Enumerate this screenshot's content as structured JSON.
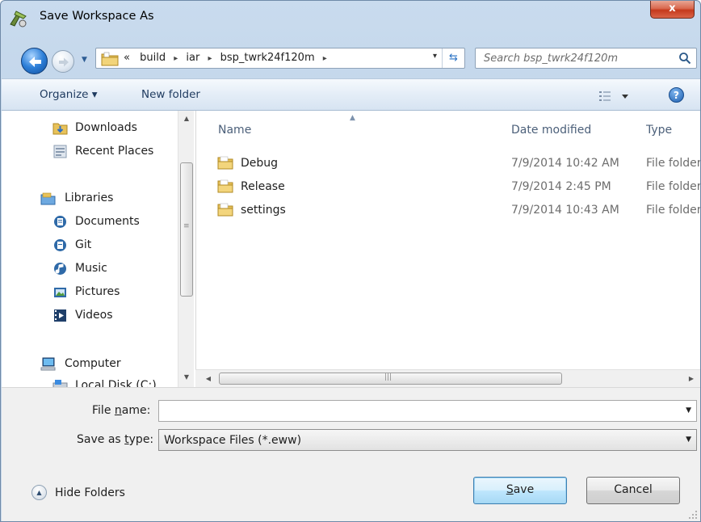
{
  "window": {
    "title": "Save Workspace As",
    "close_label": "x"
  },
  "address": {
    "overflow_glyph": "«",
    "crumbs": [
      "build",
      "iar",
      "bsp_twrk24f120m"
    ],
    "separator": "▸",
    "dropdown_glyph": "▾",
    "refresh_glyph": "⇆"
  },
  "search": {
    "placeholder": "Search bsp_twrk24f120m"
  },
  "toolbar": {
    "organize_label": "Organize ▾",
    "new_folder_label": "New folder",
    "help_label": "?"
  },
  "nav": {
    "items": [
      {
        "label": "Downloads",
        "icon": "downloads-icon"
      },
      {
        "label": "Recent Places",
        "icon": "recent-places-icon"
      },
      {
        "label": "Libraries",
        "icon": "libraries-icon"
      },
      {
        "label": "Documents",
        "icon": "documents-icon"
      },
      {
        "label": "Git",
        "icon": "git-library-icon"
      },
      {
        "label": "Music",
        "icon": "music-icon"
      },
      {
        "label": "Pictures",
        "icon": "pictures-icon"
      },
      {
        "label": "Videos",
        "icon": "videos-icon"
      },
      {
        "label": "Computer",
        "icon": "computer-icon"
      },
      {
        "label": "Local Disk (C:)",
        "icon": "local-disk-icon"
      }
    ]
  },
  "files": {
    "columns": {
      "name": "Name",
      "date": "Date modified",
      "type": "Type"
    },
    "rows": [
      {
        "name": "Debug",
        "date": "7/9/2014 10:42 AM",
        "type": "File folder"
      },
      {
        "name": "Release",
        "date": "7/9/2014 2:45 PM",
        "type": "File folder"
      },
      {
        "name": "settings",
        "date": "7/9/2014 10:43 AM",
        "type": "File folder"
      }
    ]
  },
  "form": {
    "file_name_label_pre": "File ",
    "file_name_label_accel": "n",
    "file_name_label_post": "ame:",
    "file_name_value": "",
    "save_type_label_pre": "Save as ",
    "save_type_label_accel": "t",
    "save_type_label_post": "ype:",
    "save_type_value": "Workspace Files (*.eww)"
  },
  "footer": {
    "hide_folders_label": "Hide Folders",
    "save_label_accel": "S",
    "save_label_rest": "ave",
    "cancel_label": "Cancel"
  },
  "colors": {
    "accent": "#3c7fb1",
    "close": "#c5391c",
    "folder": "#e8c25a"
  }
}
